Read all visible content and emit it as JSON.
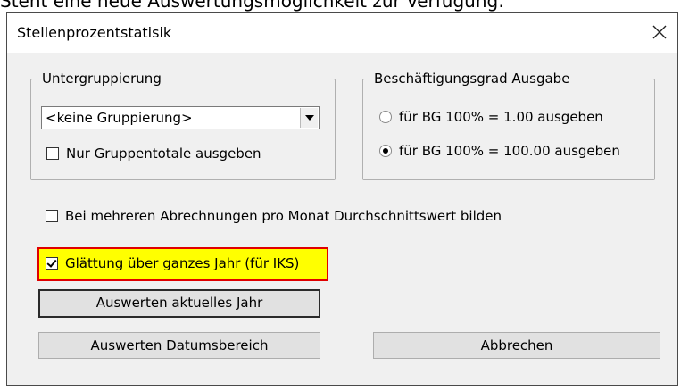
{
  "top_caption": "Steht eine neue Auswertungsmöglichkeit zur Verfügung:",
  "dialog": {
    "title": "Stellenprozentstatisik",
    "close_icon": "close-icon"
  },
  "untergruppierung": {
    "legend": "Untergruppierung",
    "select_value": "<keine Gruppierung>",
    "nur_gruppentotale": {
      "label": "Nur Gruppentotale ausgeben",
      "checked": false
    }
  },
  "beschaeftigungsgrad": {
    "legend": "Beschäftigungsgrad Ausgabe",
    "options": [
      {
        "label": "für BG 100% = 1.00 ausgeben",
        "selected": false
      },
      {
        "label": "für BG 100% = 100.00 ausgeben",
        "selected": true
      }
    ]
  },
  "options": {
    "durchschnitt": {
      "label": "Bei mehreren Abrechnungen pro Monat Durchschnittswert bilden",
      "checked": false
    },
    "glaettung": {
      "label": "Glättung über ganzes Jahr (für IKS)",
      "checked": true
    }
  },
  "buttons": {
    "auswerten_jahr": "Auswerten aktuelles Jahr",
    "auswerten_datum": "Auswerten Datumsbereich",
    "abbrechen": "Abbrechen"
  },
  "colors": {
    "highlight_fill": "#ffff00",
    "highlight_border": "#e00000",
    "dialog_bg": "#f0f0f0"
  }
}
